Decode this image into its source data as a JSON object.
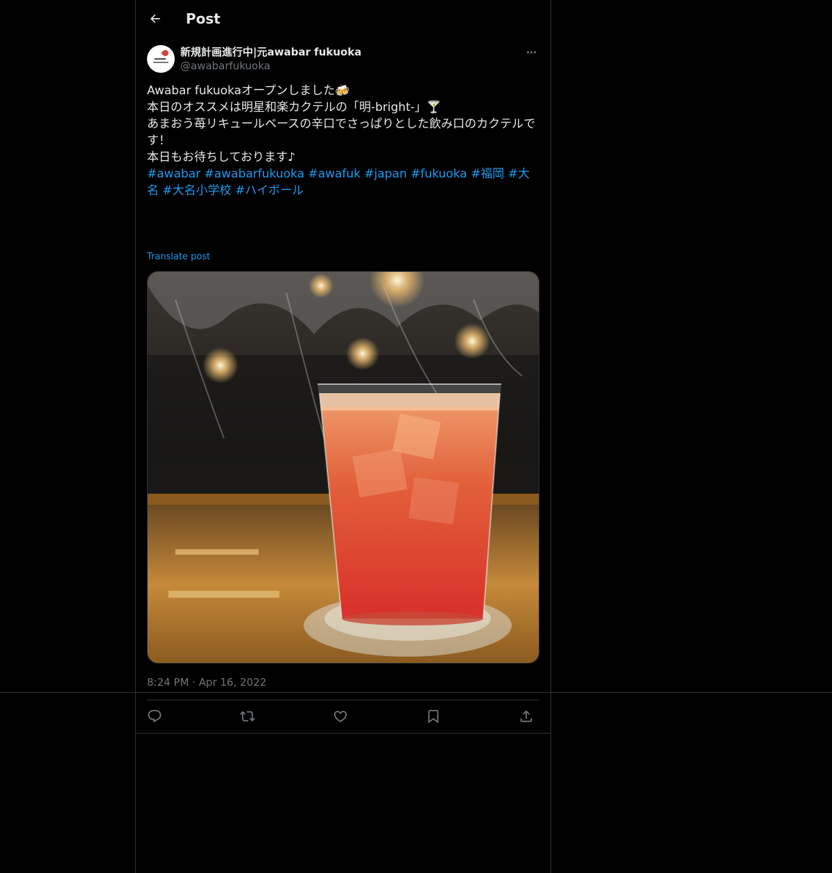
{
  "header": {
    "title": "Post"
  },
  "author": {
    "display_name": "新規計画進行中|元awabar fukuoka",
    "handle": "@awabarfukuoka"
  },
  "post": {
    "lines": [
      "Awabar fukuokaオープンしました🍻",
      "",
      "本日のオススメは明星和楽カクテルの「明-bright-」🍸",
      "あまおう苺リキュールベースの辛口でさっぱりとした飲み口のカクテルです！",
      "",
      "本日もお待ちしております♪",
      ""
    ],
    "hashtags": [
      "#awabar",
      "#awabarfukuoka",
      "#awafuk",
      "#japan",
      "#fukuoka",
      "#福岡",
      "#大名",
      "#大名小学校",
      "#ハイボール"
    ],
    "translate_label": "Translate post",
    "time": "8:24 PM",
    "separator": "·",
    "date": "Apr 16, 2022"
  },
  "actions": [
    {
      "name": "reply",
      "icon": "reply-icon"
    },
    {
      "name": "repost",
      "icon": "repost-icon"
    },
    {
      "name": "like",
      "icon": "heart-icon"
    },
    {
      "name": "bookmark",
      "icon": "bookmark-icon"
    },
    {
      "name": "share",
      "icon": "share-icon"
    }
  ],
  "colors": {
    "background": "#000000",
    "text": "#e7e9ea",
    "muted": "#71767b",
    "link": "#1d9bf0",
    "border": "#2f3336"
  }
}
